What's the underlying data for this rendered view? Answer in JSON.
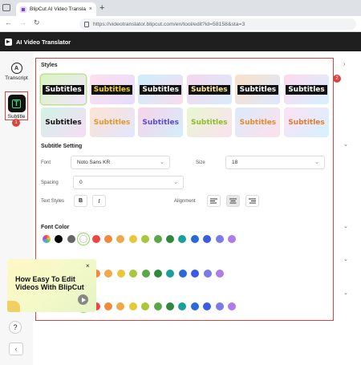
{
  "browser": {
    "tab_title": "BlipCut AI Video Translator - Fre",
    "tab_close": "×",
    "new_tab": "+",
    "url": "https://videotranslator.blipcut.com/en/tool/edit?id=58158&sta=3",
    "back": "←",
    "forward": "→",
    "reload": "↻"
  },
  "app": {
    "title": "AI Video Translator"
  },
  "sidebar": {
    "items": [
      {
        "label": "Transcript",
        "icon": "translate-icon",
        "glyph": "A"
      },
      {
        "label": "Subtitle",
        "icon": "subtitle-icon",
        "glyph": "T"
      }
    ],
    "help": "?",
    "collapse": "‹"
  },
  "annotations": {
    "badge1": "1",
    "badge2": "2"
  },
  "styles": {
    "heading": "Styles",
    "chevron": "›",
    "sample_text": "Subtitles",
    "cards": [
      {
        "bg": "linear-gradient(135deg,#d8f5c0,#f4e4ff)",
        "text_color": "#ffffff",
        "text_bg": "#111111"
      },
      {
        "bg": "linear-gradient(135deg,#fde0ec,#e7dcff)",
        "text_color": "#f2d21b",
        "text_bg": "#111111"
      },
      {
        "bg": "linear-gradient(135deg,#cdeefc,#f8dcee)",
        "text_color": "#ffffff",
        "text_bg": "#111111"
      },
      {
        "bg": "linear-gradient(135deg,#f7d6ee,#d8ecfb)",
        "text_color": "#ffe8a0",
        "text_bg": "#111111"
      },
      {
        "bg": "linear-gradient(135deg,#fbe0c8,#dce8ff)",
        "text_color": "#ffffff",
        "text_bg": "#111111"
      },
      {
        "bg": "linear-gradient(135deg,#ffd9ef,#d6f0ff)",
        "text_color": "#ffffff",
        "text_bg": "#111111"
      },
      {
        "bg": "linear-gradient(135deg,#d2f3e4,#f5dcf5)",
        "text_color": "#111111",
        "text_bg": "transparent"
      },
      {
        "bg": "linear-gradient(135deg,#ffe3d2,#e1e6ff)",
        "text_color": "#e0972b",
        "text_bg": "transparent"
      },
      {
        "bg": "linear-gradient(135deg,#f9d3e8,#d3eefc)",
        "text_color": "#5a4ad6",
        "text_bg": "transparent"
      },
      {
        "bg": "linear-gradient(135deg,#e8f7d0,#fbe1f0)",
        "text_color": "#8bbd2a",
        "text_bg": "transparent"
      },
      {
        "bg": "linear-gradient(135deg,#dbeafd,#fde1ea)",
        "text_color": "#e58a2a",
        "text_bg": "transparent"
      },
      {
        "bg": "linear-gradient(135deg,#fde1f4,#d5f2ff)",
        "text_color": "#e37a2e",
        "text_bg": "transparent"
      }
    ]
  },
  "subtitle_setting": {
    "heading": "Subtitle Setting",
    "chevron": "⌄",
    "font_label": "Font",
    "font_value": "Noto Sans KR",
    "size_label": "Size",
    "size_value": "18",
    "spacing_label": "Spacing",
    "spacing_value": "0",
    "text_styles_label": "Text Styles",
    "bold": "B",
    "italic": "I",
    "alignment_label": "Alignment",
    "dropdown_arrow": "⌄"
  },
  "font_color": {
    "heading": "Font Color",
    "chevron": "⌄",
    "swatches": [
      "#eeeeee",
      "#000000",
      "#666666",
      "#ffffff",
      "#ee4444",
      "#f08a3a",
      "#f0a848",
      "#e8c83a",
      "#a8c83a",
      "#58a848",
      "#2e8a3a",
      "#1aa09a",
      "#2a6ad8",
      "#3a5ae8",
      "#7a7ae8",
      "#b07ae8"
    ]
  },
  "outline_color": {
    "chevron": "⌄",
    "swatches": [
      "#f08a3a",
      "#f0a848",
      "#e8c83a",
      "#a8c83a",
      "#58a848",
      "#2e8a3a",
      "#1aa09a",
      "#2a6ad8",
      "#3a5ae8",
      "#7a7ae8",
      "#b07ae8"
    ]
  },
  "background_color": {
    "chevron": "⌄",
    "swatches": [
      "#eeeeee",
      "#000000",
      "#666666",
      "#ffffff",
      "#ee4444",
      "#f08a3a",
      "#f0a848",
      "#e8c83a",
      "#a8c83a",
      "#58a848",
      "#2e8a3a",
      "#1aa09a",
      "#2a6ad8",
      "#3a5ae8",
      "#7a7ae8",
      "#b07ae8"
    ]
  },
  "promo": {
    "title": "How Easy To Edit Videos With BlipCut",
    "close": "×"
  }
}
